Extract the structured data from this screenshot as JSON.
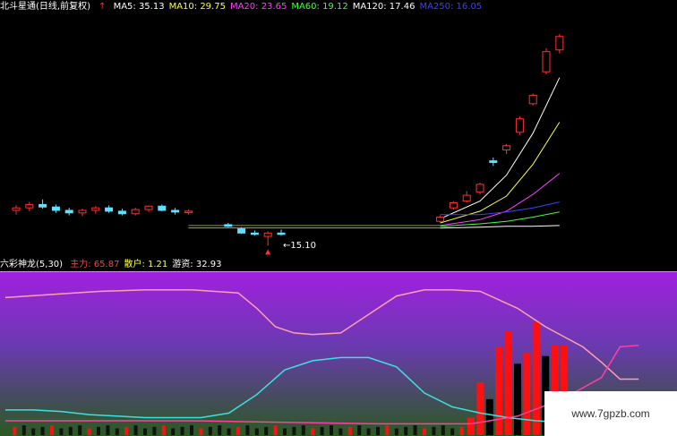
{
  "colors": {
    "ma5": "#ffffff",
    "ma10": "#ffff40",
    "ma20": "#ff40ff",
    "ma60": "#40ff40",
    "ma120": "#ffffff",
    "ma250": "#4040ff",
    "up": "#ff3030",
    "down": "#60e0ff",
    "main_force": "#ffa0b0",
    "retail": "#40e0e0",
    "hot": "#ff40a0",
    "ind_bar_red": "#ff1010",
    "ind_bar_dark": "#000000"
  },
  "main_legend": {
    "title": "北斗星通(日线,前复权)",
    "items": [
      {
        "label": "MA5: 35.13",
        "color": "#ffffff"
      },
      {
        "label": "MA10: 29.75",
        "color": "#ffff40"
      },
      {
        "label": "MA20: 23.65",
        "color": "#ff40ff"
      },
      {
        "label": "MA60: 19.12",
        "color": "#40ff40"
      },
      {
        "label": "MA120: 17.46",
        "color": "#ffffff"
      },
      {
        "label": "MA250: 16.05",
        "color": "#4040ff"
      }
    ]
  },
  "indicator_legend": {
    "title": "六彩神龙(5,30)",
    "items": [
      {
        "label": "主力: 65.87",
        "color": "#ff4040"
      },
      {
        "label": "散户: 1.21",
        "color": "#ffff40"
      },
      {
        "label": "游资: 32.93",
        "color": "#ffffff"
      }
    ]
  },
  "low_price_label": "←15.10",
  "watermark": "www.7gpzb.com",
  "chart_data": [
    {
      "type": "candlestick",
      "title": "北斗星通(日线,前复权)",
      "note": "chart areas without trading data appear as gaps",
      "ylim": [
        14.5,
        42
      ],
      "candles": [
        {
          "x": 1,
          "o": 19.3,
          "h": 19.9,
          "l": 18.8,
          "c": 19.6
        },
        {
          "x": 2,
          "o": 19.6,
          "h": 20.3,
          "l": 19.2,
          "c": 20.0
        },
        {
          "x": 3,
          "o": 20.0,
          "h": 20.6,
          "l": 19.5,
          "c": 19.7
        },
        {
          "x": 4,
          "o": 19.7,
          "h": 20.0,
          "l": 19.0,
          "c": 19.3
        },
        {
          "x": 5,
          "o": 19.3,
          "h": 19.6,
          "l": 18.7,
          "c": 19.0
        },
        {
          "x": 6,
          "o": 19.0,
          "h": 19.5,
          "l": 18.6,
          "c": 19.3
        },
        {
          "x": 7,
          "o": 19.3,
          "h": 19.8,
          "l": 18.9,
          "c": 19.6
        },
        {
          "x": 8,
          "o": 19.6,
          "h": 19.9,
          "l": 19.0,
          "c": 19.2
        },
        {
          "x": 9,
          "o": 19.2,
          "h": 19.5,
          "l": 18.7,
          "c": 18.9
        },
        {
          "x": 10,
          "o": 18.9,
          "h": 19.6,
          "l": 18.7,
          "c": 19.4
        },
        {
          "x": 11,
          "o": 19.4,
          "h": 19.9,
          "l": 19.1,
          "c": 19.8
        },
        {
          "x": 12,
          "o": 19.8,
          "h": 20.0,
          "l": 19.2,
          "c": 19.3
        },
        {
          "x": 13,
          "o": 19.3,
          "h": 19.6,
          "l": 18.8,
          "c": 19.1
        },
        {
          "x": 14,
          "o": 19.1,
          "h": 19.4,
          "l": 18.8,
          "c": 19.2
        },
        {
          "x": 17,
          "o": 17.6,
          "h": 17.8,
          "l": 17.3,
          "c": 17.4
        },
        {
          "x": 18,
          "o": 17.1,
          "h": 17.3,
          "l": 16.5,
          "c": 16.6
        },
        {
          "x": 19,
          "o": 16.6,
          "h": 16.9,
          "l": 16.3,
          "c": 16.5
        },
        {
          "x": 20,
          "o": 16.2,
          "h": 16.8,
          "l": 15.1,
          "c": 16.6
        },
        {
          "x": 21,
          "o": 16.6,
          "h": 17.0,
          "l": 16.3,
          "c": 16.5
        },
        {
          "x": 33,
          "o": 18.0,
          "h": 18.7,
          "l": 17.8,
          "c": 18.5
        },
        {
          "x": 34,
          "o": 19.6,
          "h": 20.4,
          "l": 19.4,
          "c": 20.2
        },
        {
          "x": 35,
          "o": 20.4,
          "h": 21.6,
          "l": 20.2,
          "c": 21.1
        },
        {
          "x": 36,
          "o": 21.5,
          "h": 22.6,
          "l": 21.2,
          "c": 22.4
        },
        {
          "x": 37,
          "o": 25.2,
          "h": 25.6,
          "l": 24.6,
          "c": 25.0
        },
        {
          "x": 38,
          "o": 26.5,
          "h": 27.2,
          "l": 26.0,
          "c": 27.0
        },
        {
          "x": 39,
          "o": 28.6,
          "h": 30.5,
          "l": 28.3,
          "c": 30.2
        },
        {
          "x": 40,
          "o": 32.0,
          "h": 33.2,
          "l": 31.8,
          "c": 33.0
        },
        {
          "x": 41,
          "o": 35.8,
          "h": 38.6,
          "l": 35.5,
          "c": 38.2
        },
        {
          "x": 42,
          "o": 38.4,
          "h": 40.3,
          "l": 38.0,
          "c": 40.0
        }
      ],
      "ma_series": [
        {
          "name": "MA5",
          "color": "#ffffff",
          "points": [
            [
              1,
              19.3
            ],
            [
              14,
              19.2
            ],
            [
              33,
              18.3
            ],
            [
              36,
              20.4
            ],
            [
              38,
              23.5
            ],
            [
              40,
              28.5
            ],
            [
              42,
              35.1
            ]
          ]
        },
        {
          "name": "MA10",
          "color": "#ffff40",
          "points": [
            [
              1,
              19.1
            ],
            [
              14,
              19.1
            ],
            [
              33,
              17.8
            ],
            [
              36,
              19.2
            ],
            [
              38,
              21.0
            ],
            [
              40,
              24.8
            ],
            [
              42,
              29.8
            ]
          ]
        },
        {
          "name": "MA20",
          "color": "#ff40ff",
          "points": [
            [
              1,
              18.7
            ],
            [
              14,
              18.9
            ],
            [
              33,
              17.5
            ],
            [
              36,
              18.2
            ],
            [
              38,
              19.2
            ],
            [
              40,
              21.2
            ],
            [
              42,
              23.7
            ]
          ]
        },
        {
          "name": "MA60",
          "color": "#40ff40",
          "points": [
            [
              1,
              18.3
            ],
            [
              14,
              18.6
            ],
            [
              33,
              17.4
            ],
            [
              36,
              17.7
            ],
            [
              38,
              18.0
            ],
            [
              40,
              18.5
            ],
            [
              42,
              19.1
            ]
          ]
        },
        {
          "name": "MA120",
          "color": "#ffffff",
          "points": [
            [
              1,
              18.0
            ],
            [
              14,
              18.1
            ],
            [
              33,
              17.2
            ],
            [
              36,
              17.3
            ],
            [
              38,
              17.4
            ],
            [
              40,
              17.4
            ],
            [
              42,
              17.5
            ]
          ]
        },
        {
          "name": "MA250",
          "color": "#4040ff",
          "points": [
            [
              1,
              21.2
            ],
            [
              14,
              21.0
            ],
            [
              33,
              18.8
            ],
            [
              36,
              18.8
            ],
            [
              38,
              19.1
            ],
            [
              40,
              19.6
            ],
            [
              42,
              20.3
            ]
          ]
        }
      ]
    },
    {
      "type": "line",
      "title": "六彩神龙(5,30)",
      "ylim": [
        0,
        100
      ],
      "series": [
        {
          "name": "主力",
          "color": "#ffa0b0",
          "points": [
            [
              0,
              87
            ],
            [
              5,
              89
            ],
            [
              10,
              91
            ],
            [
              15,
              92
            ],
            [
              20,
              92
            ],
            [
              25,
              90
            ],
            [
              27,
              80
            ],
            [
              29,
              68
            ],
            [
              31,
              64
            ],
            [
              33,
              63
            ],
            [
              36,
              64
            ],
            [
              39,
              76
            ],
            [
              42,
              88
            ],
            [
              45,
              92
            ],
            [
              48,
              92
            ],
            [
              51,
              91
            ],
            [
              55,
              80
            ],
            [
              58,
              68
            ],
            [
              62,
              55
            ],
            [
              64,
              45
            ],
            [
              66,
              34
            ],
            [
              68,
              34
            ]
          ]
        },
        {
          "name": "散户",
          "color": "#40e0e0",
          "points": [
            [
              0,
              14
            ],
            [
              3,
              14
            ],
            [
              6,
              13
            ],
            [
              9,
              11
            ],
            [
              12,
              10
            ],
            [
              15,
              9
            ],
            [
              18,
              9
            ],
            [
              21,
              9
            ],
            [
              24,
              12
            ],
            [
              27,
              24
            ],
            [
              30,
              40
            ],
            [
              33,
              46
            ],
            [
              36,
              48
            ],
            [
              39,
              48
            ],
            [
              42,
              42
            ],
            [
              45,
              25
            ],
            [
              48,
              16
            ],
            [
              51,
              12
            ],
            [
              54,
              9
            ],
            [
              57,
              7
            ],
            [
              60,
              6
            ],
            [
              63,
              5
            ],
            [
              66,
              4
            ],
            [
              68,
              4
            ]
          ]
        },
        {
          "name": "游资",
          "color": "#ff40a0",
          "points": [
            [
              0,
              7
            ],
            [
              10,
              7
            ],
            [
              20,
              7
            ],
            [
              30,
              6
            ],
            [
              40,
              5
            ],
            [
              48,
              5
            ],
            [
              50,
              5
            ],
            [
              52,
              7
            ],
            [
              55,
              10
            ],
            [
              58,
              17
            ],
            [
              61,
              25
            ],
            [
              64,
              35
            ],
            [
              66,
              55
            ],
            [
              68,
              56
            ]
          ]
        }
      ],
      "bars": [
        {
          "x": 50,
          "value": 9,
          "color": "#ff1010"
        },
        {
          "x": 51,
          "value": 32,
          "color": "#ff1010"
        },
        {
          "x": 52,
          "value": 21,
          "color": "#000000"
        },
        {
          "x": 53,
          "value": 55,
          "color": "#ff1010"
        },
        {
          "x": 54,
          "value": 65,
          "color": "#ff1010"
        },
        {
          "x": 55,
          "value": 44,
          "color": "#000000"
        },
        {
          "x": 56,
          "value": 51,
          "color": "#ff1010"
        },
        {
          "x": 57,
          "value": 71,
          "color": "#ff1010"
        },
        {
          "x": 58,
          "value": 49,
          "color": "#000000"
        },
        {
          "x": 59,
          "value": 56,
          "color": "#ff1010"
        },
        {
          "x": 60,
          "value": 56,
          "color": "#ff1010"
        },
        {
          "x": 61,
          "value": 26,
          "color": "#000000"
        },
        {
          "x": 62,
          "value": 13,
          "color": "#000000"
        }
      ]
    }
  ]
}
